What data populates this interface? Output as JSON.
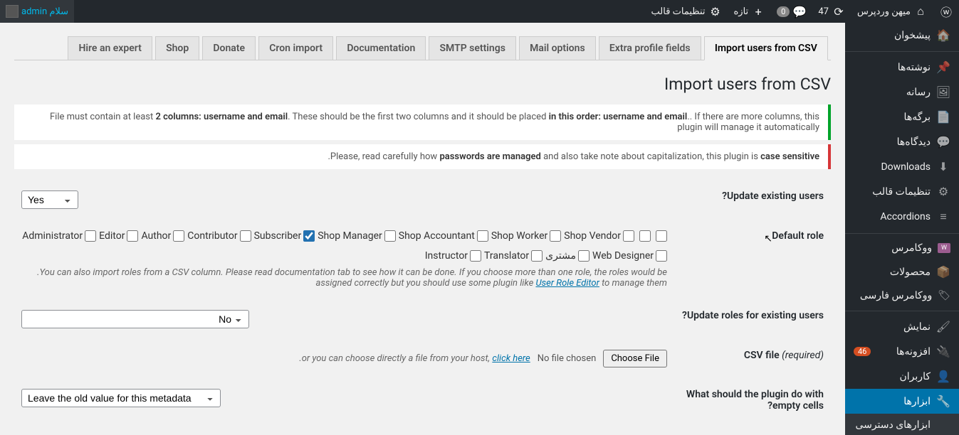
{
  "adminbar": {
    "right": {
      "wp_logo": "ⓦ",
      "site_name": "میهن وردپرس",
      "updates_count": "47",
      "comments_count": "0",
      "new_label": "تازه",
      "theme_settings": "تنظیمات قالب"
    },
    "left": {
      "greeting": "سلام admin"
    }
  },
  "menu": {
    "dashboard": "پیشخوان",
    "posts": "نوشته‌ها",
    "media": "رسانه",
    "pages": "برگه‌ها",
    "comments": "دیدگاه‌ها",
    "downloads": "Downloads",
    "theme_settings": "تنظیمات قالب",
    "accordions": "Accordions",
    "woocommerce": "ووکامرس",
    "products": "محصولات",
    "woo_farsi": "ووکامرس فارسی",
    "appearance": "نمایش",
    "plugins": "افزونه‌ها",
    "plugins_count": "46",
    "users": "کاربران",
    "tools": "ابزارها",
    "all_events": "ابزارهای دسترسی"
  },
  "tabs": {
    "import": "Import users from CSV",
    "extra": "Extra profile fields",
    "mail": "Mail options",
    "smtp": "SMTP settings",
    "doc": "Documentation",
    "cron": "Cron import",
    "donate": "Donate",
    "shop": "Shop",
    "hire": "Hire an expert"
  },
  "page_title": "Import users from CSV",
  "notice1": {
    "p1": "File must contain at least ",
    "b1": "2 columns: username and email",
    "p2": ". These should be the first two columns and it should be placed ",
    "b2": "in this order: username and email",
    "p3": ". If there are more columns, this plugin will manage it automatically"
  },
  "notice2": {
    "p1": "Please, read carefully how ",
    "b1": "passwords are managed",
    "p2": " and also take note about capitalization, this plugin is ",
    "b2": "case sensitive"
  },
  "form": {
    "update_existing": {
      "label": "Update existing users?",
      "value": "Yes"
    },
    "default_role": {
      "label": "Default role",
      "roles": [
        {
          "id": "blank1",
          "label": "",
          "checked": false
        },
        {
          "id": "blank2",
          "label": "",
          "checked": false
        },
        {
          "id": "administrator",
          "label": "Administrator",
          "checked": false
        },
        {
          "id": "editor",
          "label": "Editor",
          "checked": false
        },
        {
          "id": "author",
          "label": "Author",
          "checked": false
        },
        {
          "id": "contributor",
          "label": "Contributor",
          "checked": false
        },
        {
          "id": "subscriber",
          "label": "Subscriber",
          "checked": true
        },
        {
          "id": "shop_manager",
          "label": "Shop Manager",
          "checked": false
        },
        {
          "id": "shop_accountant",
          "label": "Shop Accountant",
          "checked": false
        },
        {
          "id": "shop_worker",
          "label": "Shop Worker",
          "checked": false
        },
        {
          "id": "shop_vendor",
          "label": "Shop Vendor",
          "checked": false
        },
        {
          "id": "instructor",
          "label": "Instructor",
          "checked": false
        },
        {
          "id": "translator",
          "label": "Translator",
          "checked": false
        },
        {
          "id": "customer",
          "label": "مشتری",
          "checked": false
        },
        {
          "id": "web_designer",
          "label": "Web Designer",
          "checked": false
        }
      ],
      "desc1": "You can also import roles from a CSV column. Please read documentation tab to see how it can be done. If you choose more than one role, the roles would be assigned correctly but you should use some plugin like ",
      "desc_link": "User Role Editor",
      "desc2": " to manage them"
    },
    "update_roles": {
      "label": "Update roles for existing users?",
      "value": "No"
    },
    "csv_file": {
      "label_pre": "CSV file ",
      "label_em": "(required)",
      "button": "Choose File",
      "status": "No file chosen",
      "note_pre": "or you can choose directly a file from your host, ",
      "note_link": "click here"
    },
    "empty_cells": {
      "label": "What should the plugin do with empty cells?",
      "value": "Leave the old value for this metadata"
    }
  }
}
